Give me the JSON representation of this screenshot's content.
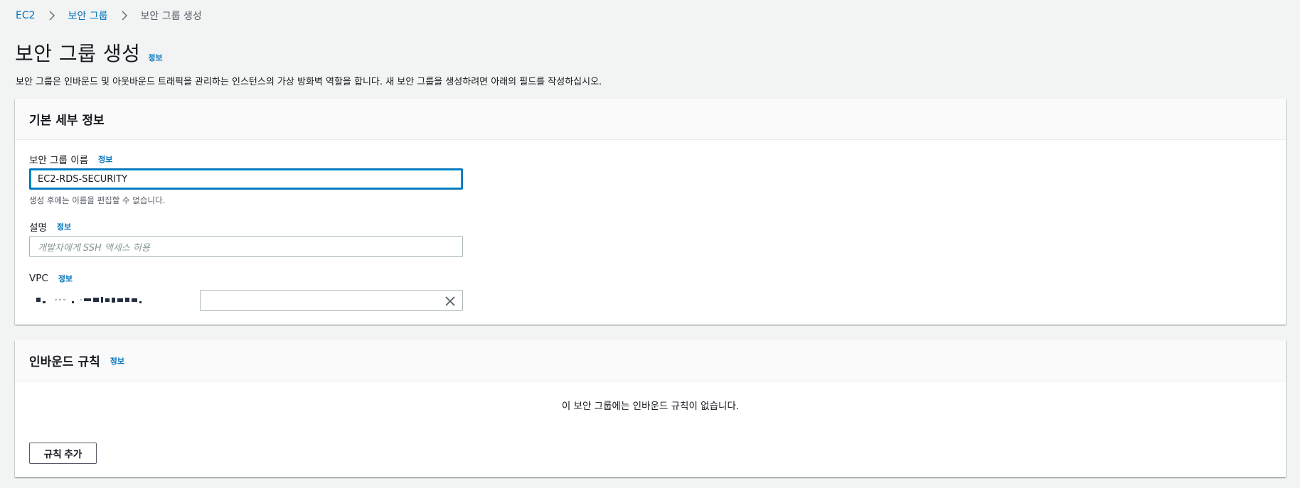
{
  "breadcrumb": {
    "items": [
      {
        "label": "EC2"
      },
      {
        "label": "보안 그룹"
      },
      {
        "label": "보안 그룹 생성"
      }
    ]
  },
  "header": {
    "title": "보안 그룹 생성",
    "info": "정보",
    "description": "보안 그룹은 인바운드 및 아웃바운드 트래픽을 관리하는 인스턴스의 가상 방화벽 역할을 합니다. 새 보안 그룹을 생성하려면 아래의 필드를 작성하십시오."
  },
  "basic_details": {
    "title": "기본 세부 정보",
    "name_field": {
      "label": "보안 그룹 이름",
      "info": "정보",
      "value": "EC2-RDS-SECURITY",
      "hint": "생성 후에는 이름을 편집할 수 없습니다."
    },
    "description_field": {
      "label": "설명",
      "info": "정보",
      "value": "",
      "placeholder": "개발자에게 SSH 액세스 허용"
    },
    "vpc_field": {
      "label": "VPC",
      "info": "정보"
    }
  },
  "inbound_rules": {
    "title": "인바운드 규칙",
    "info": "정보",
    "empty_message": "이 보안 그룹에는 인바운드 규칙이 없습니다.",
    "add_rule_label": "규칙 추가"
  },
  "colors": {
    "link": "#0073bb",
    "focus": "#0073bb",
    "background": "#f2f3f3",
    "text": "#16191f"
  }
}
